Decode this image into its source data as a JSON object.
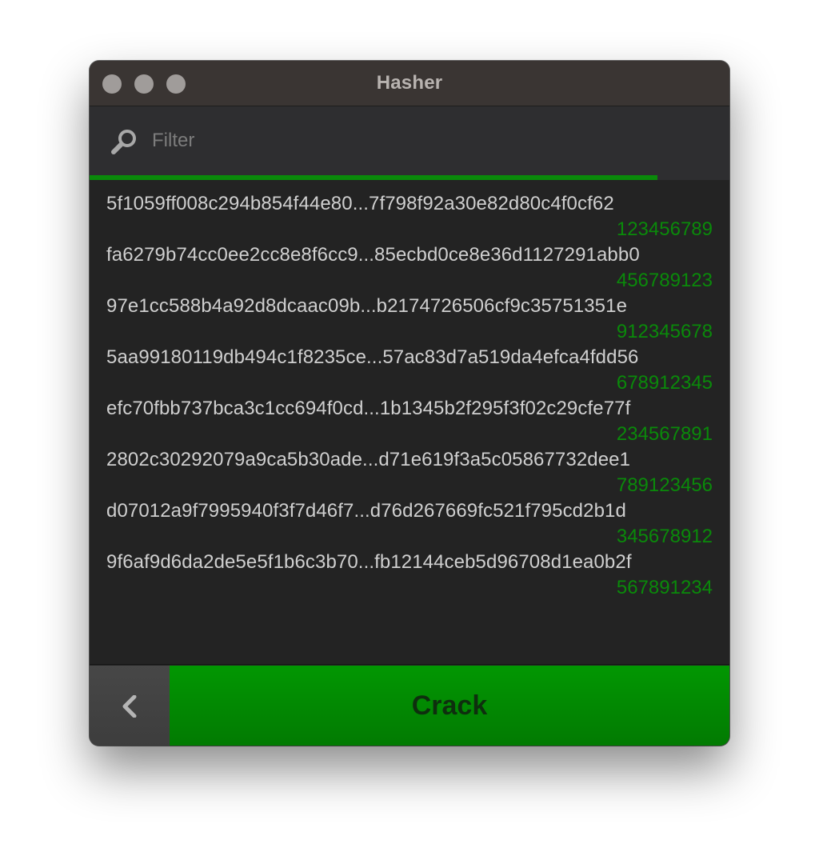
{
  "window": {
    "title": "Hasher"
  },
  "filter": {
    "placeholder": "Filter",
    "value": ""
  },
  "progress": {
    "fraction": 0.887,
    "color": "#0a8a0a"
  },
  "results": [
    {
      "hash": "5f1059ff008c294b854f44e80...7f798f92a30e82d80c4f0cf62",
      "plaintext": "123456789"
    },
    {
      "hash": "fa6279b74cc0ee2cc8e8f6cc9...85ecbd0ce8e36d1127291abb0",
      "plaintext": "456789123"
    },
    {
      "hash": "97e1cc588b4a92d8dcaac09b...b2174726506cf9c35751351e",
      "plaintext": "912345678"
    },
    {
      "hash": "5aa99180119db494c1f8235ce...57ac83d7a519da4efca4fdd56",
      "plaintext": "678912345"
    },
    {
      "hash": "efc70fbb737bca3c1cc694f0cd...1b1345b2f295f3f02c29cfe77f",
      "plaintext": "234567891"
    },
    {
      "hash": "2802c30292079a9ca5b30ade...d71e619f3a5c05867732dee1",
      "plaintext": "789123456"
    },
    {
      "hash": "d07012a9f7995940f3f7d46f7...d76d267669fc521f795cd2b1d",
      "plaintext": "345678912"
    },
    {
      "hash": "9f6af9d6da2de5e5f1b6c3b70...fb12144ceb5d96708d1ea0b2f",
      "plaintext": "567891234"
    }
  ],
  "toolbar": {
    "crack_label": "Crack"
  },
  "colors": {
    "accent": "#0a8a0a",
    "crack_button": "#029702",
    "titlebar": "#3a3533",
    "background": "#232323"
  },
  "icons": {
    "search": "search-icon",
    "back": "chevron-left-icon"
  }
}
